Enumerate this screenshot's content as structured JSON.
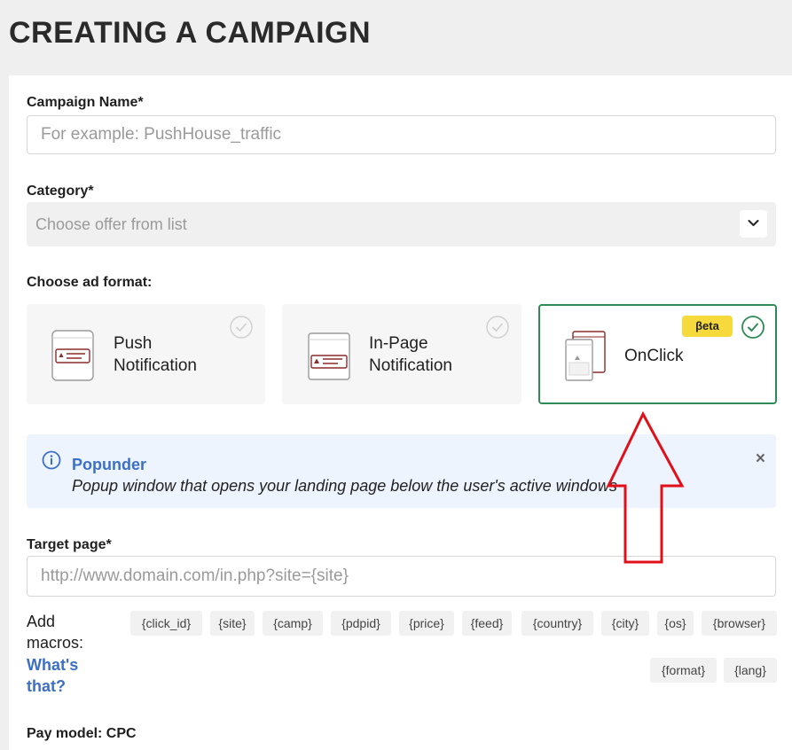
{
  "page": {
    "title": "CREATING A CAMPAIGN"
  },
  "campaign_name": {
    "label": "Campaign Name*",
    "placeholder": "For example: PushHouse_traffic"
  },
  "category": {
    "label": "Category*",
    "placeholder": "Choose offer from list"
  },
  "ad_format": {
    "label": "Choose ad format:",
    "options": [
      {
        "line1": "Push",
        "line2": "Notification",
        "selected": false
      },
      {
        "line1": "In-Page",
        "line2": "Notification",
        "selected": false
      },
      {
        "line1": "OnClick",
        "badge": "βeta",
        "selected": true
      }
    ]
  },
  "info": {
    "title": "Popunder",
    "description": "Popup window that opens your landing page below the user's active windows",
    "close": "×"
  },
  "target_page": {
    "label": "Target page*",
    "placeholder": "http://www.domain.com/in.php?site={site}"
  },
  "macros": {
    "label": "Add macros:",
    "help": "What's that?",
    "tags": [
      "{click_id}",
      "{site}",
      "{camp}",
      "{pdpid}",
      "{price}",
      "{feed}",
      "{country}",
      "{city}",
      "{os}",
      "{browser}",
      "{format}",
      "{lang}"
    ]
  },
  "pay_model": {
    "label": "Pay model: CPC"
  },
  "colors": {
    "accent_green": "#2f8a55",
    "link_blue": "#3c6fc6",
    "beta_yellow": "#f6d93a",
    "arrow_red": "#e0101a"
  }
}
